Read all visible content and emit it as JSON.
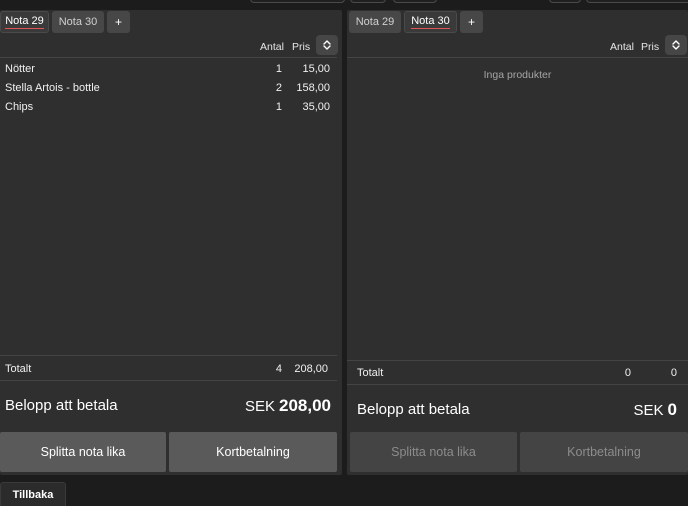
{
  "columns": {
    "qty": "Antal",
    "price": "Pris"
  },
  "left": {
    "tabs": [
      {
        "label": "Nota 29",
        "active": true
      },
      {
        "label": "Nota 30",
        "active": false
      },
      {
        "label": "+",
        "active": false
      }
    ],
    "items": [
      {
        "name": "Nötter",
        "qty": "1",
        "price": "15,00"
      },
      {
        "name": "Stella Artois - bottle",
        "qty": "2",
        "price": "158,00"
      },
      {
        "name": "Chips",
        "qty": "1",
        "price": "35,00"
      }
    ],
    "total_label": "Totalt",
    "total_qty": "4",
    "total_value": "208,00",
    "pay_label": "Belopp att betala",
    "currency": "SEK",
    "pay_amount": "208,00",
    "split_button": "Splitta nota lika",
    "card_button": "Kortbetalning"
  },
  "right": {
    "tabs": [
      {
        "label": "Nota 29",
        "active": false
      },
      {
        "label": "Nota 30",
        "active": true
      },
      {
        "label": "+",
        "active": false
      }
    ],
    "empty_message": "Inga produkter",
    "total_label": "Totalt",
    "total_qty": "0",
    "total_value": "0",
    "pay_label": "Belopp att betala",
    "currency": "SEK",
    "pay_amount": "0",
    "split_button": "Splitta nota lika",
    "card_button": "Kortbetalning"
  },
  "back_button": "Tillbaka"
}
